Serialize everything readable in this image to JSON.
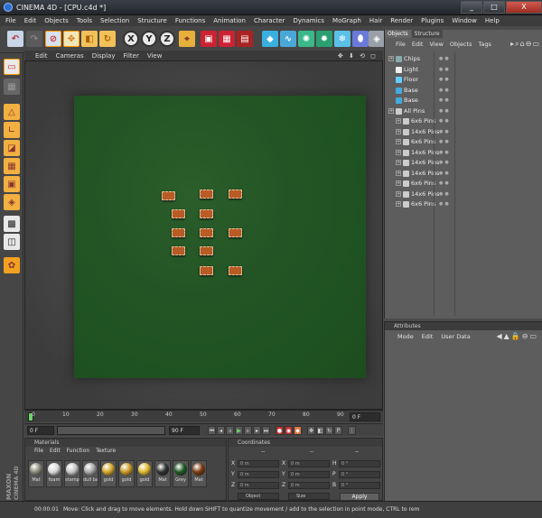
{
  "window": {
    "title": "CINEMA 4D - [CPU.c4d *]",
    "buttons": [
      "_",
      "□",
      "X"
    ]
  },
  "menubar": [
    "File",
    "Edit",
    "Objects",
    "Tools",
    "Selection",
    "Structure",
    "Functions",
    "Animation",
    "Character",
    "Dynamics",
    "MoGraph",
    "Hair",
    "Render",
    "Plugins",
    "Window",
    "Help"
  ],
  "toolbar": {
    "axis_x": "X",
    "axis_y": "Y",
    "axis_z": "Z"
  },
  "viewport": {
    "menu": [
      "Edit",
      "Cameras",
      "Display",
      "Filter",
      "View"
    ],
    "nav": "✥ ⬇ ⟲ ◻"
  },
  "timeline": {
    "ticks": [
      "0",
      "10",
      "20",
      "30",
      "40",
      "50",
      "60",
      "70",
      "80",
      "90"
    ],
    "current_frame": "0 F",
    "start_field": "0 F",
    "end_field": "90 F"
  },
  "materials": {
    "title": "Materials",
    "menu": [
      "File",
      "Edit",
      "Function",
      "Texture"
    ],
    "items": [
      {
        "label": "Mat",
        "color": "#8a8a7a"
      },
      {
        "label": "foam",
        "color": "#d8d8d8"
      },
      {
        "label": "stamp",
        "color": "#c8c8c8"
      },
      {
        "label": "dull ba",
        "color": "#a8a8a8"
      },
      {
        "label": "gold",
        "color": "#d4a82a"
      },
      {
        "label": "gold",
        "color": "#c99a20"
      },
      {
        "label": "gold",
        "color": "#e0b830"
      },
      {
        "label": "Mat",
        "color": "#303030"
      },
      {
        "label": "Grey",
        "color": "#1e5a24"
      },
      {
        "label": "Mat",
        "color": "#7a3a10"
      }
    ]
  },
  "coordinates": {
    "title": "Coordinates",
    "col_headers": [
      "--",
      "--",
      "--"
    ],
    "rows": [
      {
        "l1": "X",
        "v1": "0 m",
        "l2": "X",
        "v2": "0 m",
        "l3": "H",
        "v3": "0 °"
      },
      {
        "l1": "Y",
        "v1": "0 m",
        "l2": "Y",
        "v2": "0 m",
        "l3": "P",
        "v3": "0 °"
      },
      {
        "l1": "Z",
        "v1": "0 m",
        "l2": "Z",
        "v2": "0 m",
        "l3": "B",
        "v3": "0 °"
      }
    ],
    "mode_select": "Object",
    "size_select": "Size",
    "apply_label": "Apply"
  },
  "objects_panel": {
    "tabs": [
      "Objects",
      "Structure"
    ],
    "menu": [
      "File",
      "Edit",
      "View",
      "Objects",
      "Tags"
    ],
    "items": [
      {
        "name": "Chips",
        "icon_color": "#8aa",
        "indent": 0
      },
      {
        "name": "Light",
        "icon_color": "#eee",
        "indent": 0
      },
      {
        "name": "Floor",
        "icon_color": "#6cf",
        "indent": 0
      },
      {
        "name": "Base",
        "icon_color": "#4ad",
        "indent": 0
      },
      {
        "name": "Base",
        "icon_color": "#4ad",
        "indent": 0
      },
      {
        "name": "All Pins",
        "icon_color": "#ccc",
        "indent": 0
      },
      {
        "name": "6x6 Pins",
        "icon_color": "#ccc",
        "indent": 1
      },
      {
        "name": "14x6 Pins",
        "icon_color": "#ccc",
        "indent": 1
      },
      {
        "name": "6x6 Pins",
        "icon_color": "#ccc",
        "indent": 1
      },
      {
        "name": "14x6 Pins",
        "icon_color": "#ccc",
        "indent": 1
      },
      {
        "name": "14x6 Pins",
        "icon_color": "#ccc",
        "indent": 1
      },
      {
        "name": "14x6 Pins",
        "icon_color": "#ccc",
        "indent": 1
      },
      {
        "name": "6x6 Pins",
        "icon_color": "#ccc",
        "indent": 1
      },
      {
        "name": "14x6 Pins",
        "icon_color": "#ccc",
        "indent": 1
      },
      {
        "name": "6x6 Pins",
        "icon_color": "#ccc",
        "indent": 1
      }
    ]
  },
  "attributes_panel": {
    "title": "Attributes",
    "menu": [
      "Mode",
      "Edit",
      "User Data"
    ]
  },
  "statusbar": {
    "time": "00:00:01",
    "message": "Move: Click and drag to move elements. Hold down SHIFT to quantize movement / add to the selection in point mode, CTRL to rem"
  },
  "branding": {
    "maxon": "MAXON",
    "product": "CINEMA 4D"
  }
}
